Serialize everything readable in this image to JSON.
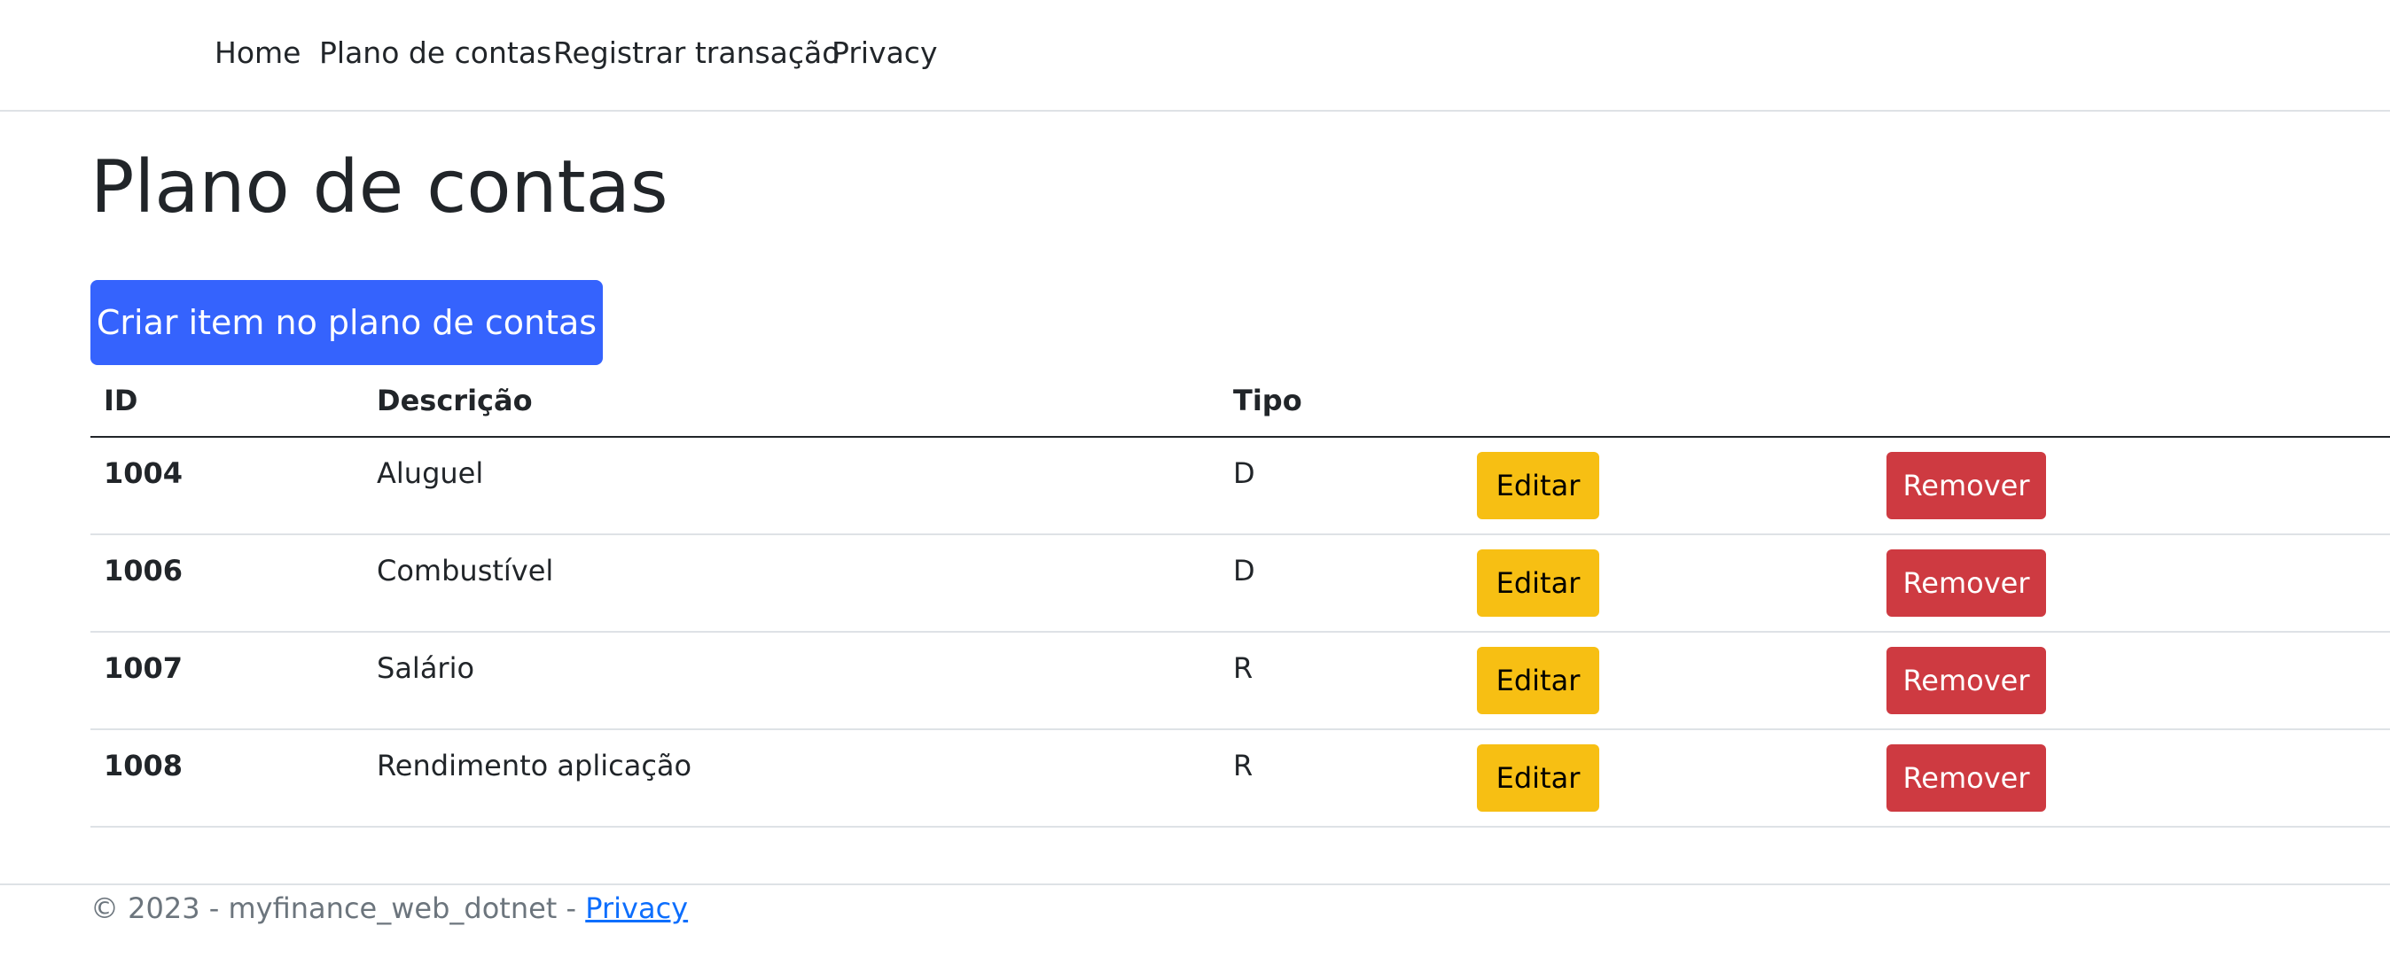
{
  "nav": {
    "items": [
      {
        "label": "Home"
      },
      {
        "label": "Plano de contas"
      },
      {
        "label": "Registrar transação"
      },
      {
        "label": "Privacy"
      }
    ]
  },
  "page": {
    "title": "Plano de contas",
    "create_button": "Criar item no plano de contas"
  },
  "table": {
    "columns": [
      "ID",
      "Descrição",
      "Tipo"
    ],
    "rows": [
      {
        "id": "1004",
        "descricao": "Aluguel",
        "tipo": "D"
      },
      {
        "id": "1006",
        "descricao": "Combustível",
        "tipo": "D"
      },
      {
        "id": "1007",
        "descricao": "Salário",
        "tipo": "R"
      },
      {
        "id": "1008",
        "descricao": "Rendimento aplicação",
        "tipo": "R"
      }
    ],
    "edit_label": "Editar",
    "remove_label": "Remover"
  },
  "footer": {
    "text": "© 2023 - myfinance_web_dotnet - ",
    "link": "Privacy"
  },
  "colors": {
    "primary": "#3563fd",
    "warning": "#f7bf13",
    "danger": "#ce3a41"
  }
}
